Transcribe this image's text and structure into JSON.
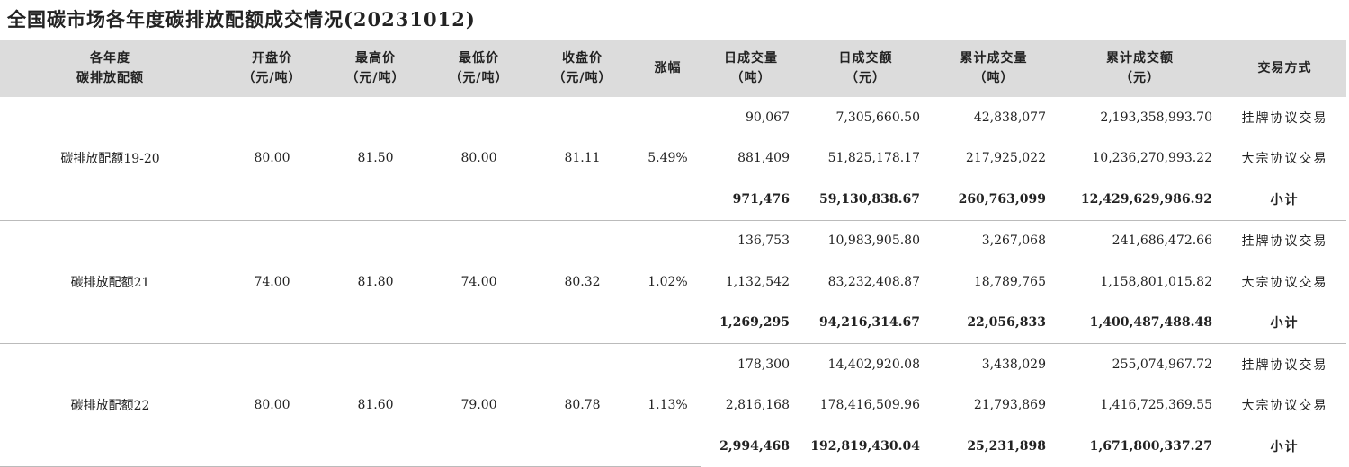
{
  "title": "全国碳市场各年度碳排放配额成交情况(20231012)",
  "headers": [
    [
      "各年度",
      "碳排放配额"
    ],
    [
      "开盘价",
      "（元/吨）"
    ],
    [
      "最高价",
      "（元/吨）"
    ],
    [
      "最低价",
      "（元/吨）"
    ],
    [
      "收盘价",
      "（元/吨）"
    ],
    [
      "涨幅",
      ""
    ],
    [
      "日成交量",
      "（吨）"
    ],
    [
      "日成交额",
      "（元）"
    ],
    [
      "累计成交量",
      "（吨）"
    ],
    [
      "累计成交额",
      "（元）"
    ],
    [
      "交易方式",
      ""
    ]
  ],
  "groups": [
    {
      "name": "碳排放配额19-20",
      "open": "80.00",
      "high": "81.50",
      "low": "80.00",
      "close": "81.11",
      "change": "5.49%",
      "rows": [
        {
          "daily_volume": "90,067",
          "daily_amount": "7,305,660.50",
          "cum_volume": "42,838,077",
          "cum_amount": "2,193,358,993.70",
          "method": "挂牌协议交易"
        },
        {
          "daily_volume": "881,409",
          "daily_amount": "51,825,178.17",
          "cum_volume": "217,925,022",
          "cum_amount": "10,236,270,993.22",
          "method": "大宗协议交易"
        },
        {
          "daily_volume": "971,476",
          "daily_amount": "59,130,838.67",
          "cum_volume": "260,763,099",
          "cum_amount": "12,429,629,986.92",
          "method": "小计"
        }
      ]
    },
    {
      "name": "碳排放配额21",
      "open": "74.00",
      "high": "81.80",
      "low": "74.00",
      "close": "80.32",
      "change": "1.02%",
      "rows": [
        {
          "daily_volume": "136,753",
          "daily_amount": "10,983,905.80",
          "cum_volume": "3,267,068",
          "cum_amount": "241,686,472.66",
          "method": "挂牌协议交易"
        },
        {
          "daily_volume": "1,132,542",
          "daily_amount": "83,232,408.87",
          "cum_volume": "18,789,765",
          "cum_amount": "1,158,801,015.82",
          "method": "大宗协议交易"
        },
        {
          "daily_volume": "1,269,295",
          "daily_amount": "94,216,314.67",
          "cum_volume": "22,056,833",
          "cum_amount": "1,400,487,488.48",
          "method": "小计"
        }
      ]
    },
    {
      "name": "碳排放配额22",
      "open": "80.00",
      "high": "81.60",
      "low": "79.00",
      "close": "80.78",
      "change": "1.13%",
      "rows": [
        {
          "daily_volume": "178,300",
          "daily_amount": "14,402,920.08",
          "cum_volume": "3,438,029",
          "cum_amount": "255,074,967.72",
          "method": "挂牌协议交易"
        },
        {
          "daily_volume": "2,816,168",
          "daily_amount": "178,416,509.96",
          "cum_volume": "21,793,869",
          "cum_amount": "1,416,725,369.55",
          "method": "大宗协议交易"
        },
        {
          "daily_volume": "2,994,468",
          "daily_amount": "192,819,430.04",
          "cum_volume": "25,231,898",
          "cum_amount": "1,671,800,337.27",
          "method": "小计"
        }
      ]
    }
  ]
}
